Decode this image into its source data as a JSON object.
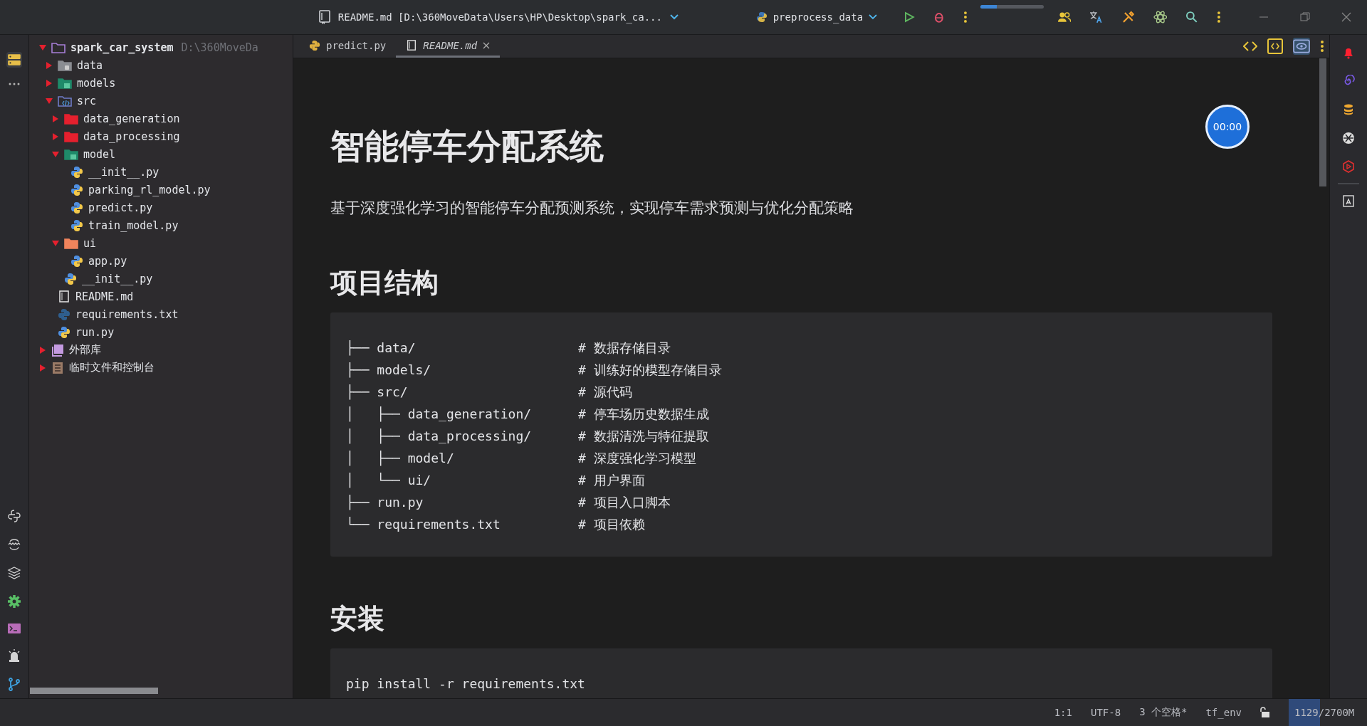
{
  "title_bar": {
    "file_title": "README.md [D:\\360MoveData\\Users\\HP\\Desktop\\spark_ca...",
    "run_config": "preprocess_data",
    "progress": {
      "level": 0.25
    }
  },
  "left_strip": [
    {
      "selected": true
    },
    {
      "selected": false
    }
  ],
  "project_tree": [
    {
      "name": "spark_car_system",
      "hint": "D:\\360MoveDa",
      "kind": "folder-project",
      "expanded": true,
      "children": [
        {
          "name": "data",
          "kind": "folder-grey",
          "expanded": false
        },
        {
          "name": "models",
          "kind": "folder-green",
          "expanded": false
        },
        {
          "name": "src",
          "kind": "folder-src",
          "expanded": true,
          "children": [
            {
              "name": "data_generation",
              "kind": "folder-red",
              "expanded": false
            },
            {
              "name": "data_processing",
              "kind": "folder-red",
              "expanded": false
            },
            {
              "name": "model",
              "kind": "folder-green",
              "expanded": true,
              "children": [
                {
                  "name": "__init__.py",
                  "kind": "python"
                },
                {
                  "name": "parking_rl_model.py",
                  "kind": "python"
                },
                {
                  "name": "predict.py",
                  "kind": "python"
                },
                {
                  "name": "train_model.py",
                  "kind": "python"
                }
              ]
            },
            {
              "name": "ui",
              "kind": "folder-orange",
              "expanded": true,
              "children": [
                {
                  "name": "app.py",
                  "kind": "python"
                }
              ]
            },
            {
              "name": "__init__.py",
              "kind": "python"
            }
          ]
        },
        {
          "name": "README.md",
          "kind": "markdown"
        },
        {
          "name": "requirements.txt",
          "kind": "python-dark"
        },
        {
          "name": "run.py",
          "kind": "python"
        }
      ]
    },
    {
      "name": "外部库",
      "kind": "library",
      "expanded": false
    },
    {
      "name": "临时文件和控制台",
      "kind": "scratch",
      "expanded": false
    }
  ],
  "tabs": [
    {
      "label": "predict.py",
      "kind": "python",
      "selected": false
    },
    {
      "label": "README.md",
      "kind": "markdown",
      "selected": true
    }
  ],
  "view_modes": [
    {
      "selected": false
    },
    {
      "selected": false
    },
    {
      "selected": true
    }
  ],
  "document": {
    "title": "智能停车分配系统",
    "description": "基于深度强化学习的智能停车分配预测系统，实现停车需求预测与优化分配策略",
    "sections": [
      {
        "heading": "项目结构",
        "code": [
          {
            "path": "├── data/",
            "comment": "# 数据存储目录"
          },
          {
            "path": "├── models/",
            "comment": "# 训练好的模型存储目录"
          },
          {
            "path": "├── src/",
            "comment": "# 源代码"
          },
          {
            "path": "│   ├── data_generation/",
            "comment": "# 停车场历史数据生成"
          },
          {
            "path": "│   ├── data_processing/",
            "comment": "# 数据清洗与特征提取"
          },
          {
            "path": "│   ├── model/",
            "comment": "# 深度强化学习模型"
          },
          {
            "path": "│   └── ui/",
            "comment": "# 用户界面"
          },
          {
            "path": "├── run.py",
            "comment": "# 项目入口脚本"
          },
          {
            "path": "└── requirements.txt",
            "comment": "# 项目依赖"
          }
        ]
      },
      {
        "heading": "安装",
        "code": [
          {
            "path": "pip install -r requirements.txt"
          }
        ]
      }
    ]
  },
  "timer": "00:00",
  "status_bar": {
    "items": [
      "1:1",
      "UTF-8",
      "3 个空格*",
      "tf_env"
    ],
    "memory": {
      "text": "1129/2700M",
      "level": 0.4
    }
  }
}
